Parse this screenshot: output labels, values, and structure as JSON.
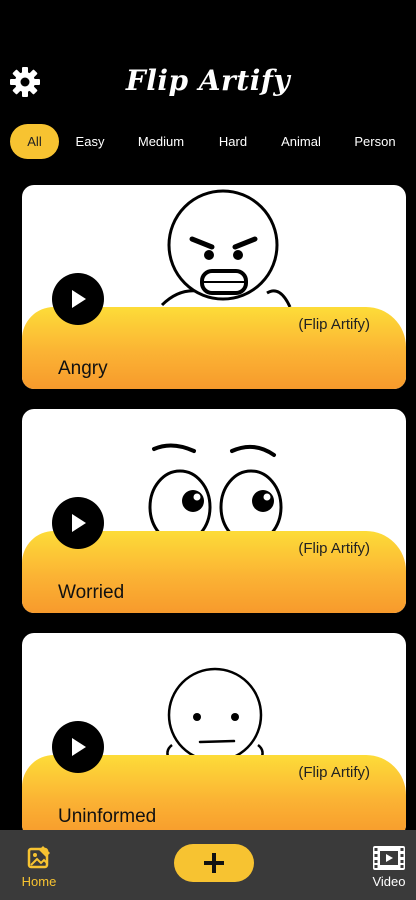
{
  "header": {
    "title": "Flip Artify",
    "settings_icon": "gear-icon"
  },
  "filters": {
    "selected": "All",
    "items": [
      "All",
      "Easy",
      "Medium",
      "Hard",
      "Animal",
      "Person"
    ]
  },
  "colors": {
    "accent": "#f7c331",
    "background": "#000000",
    "nav": "#3a3a3a"
  },
  "cards": [
    {
      "title": "Angry",
      "brand": "(Flip Artify)",
      "icon": "play-icon"
    },
    {
      "title": "Worried",
      "brand": "(Flip Artify)",
      "icon": "play-icon"
    },
    {
      "title": "Uninformed",
      "brand": "(Flip Artify)",
      "icon": "play-icon"
    }
  ],
  "nav": {
    "home_label": "Home",
    "video_label": "Video",
    "add_icon": "plus-icon"
  }
}
